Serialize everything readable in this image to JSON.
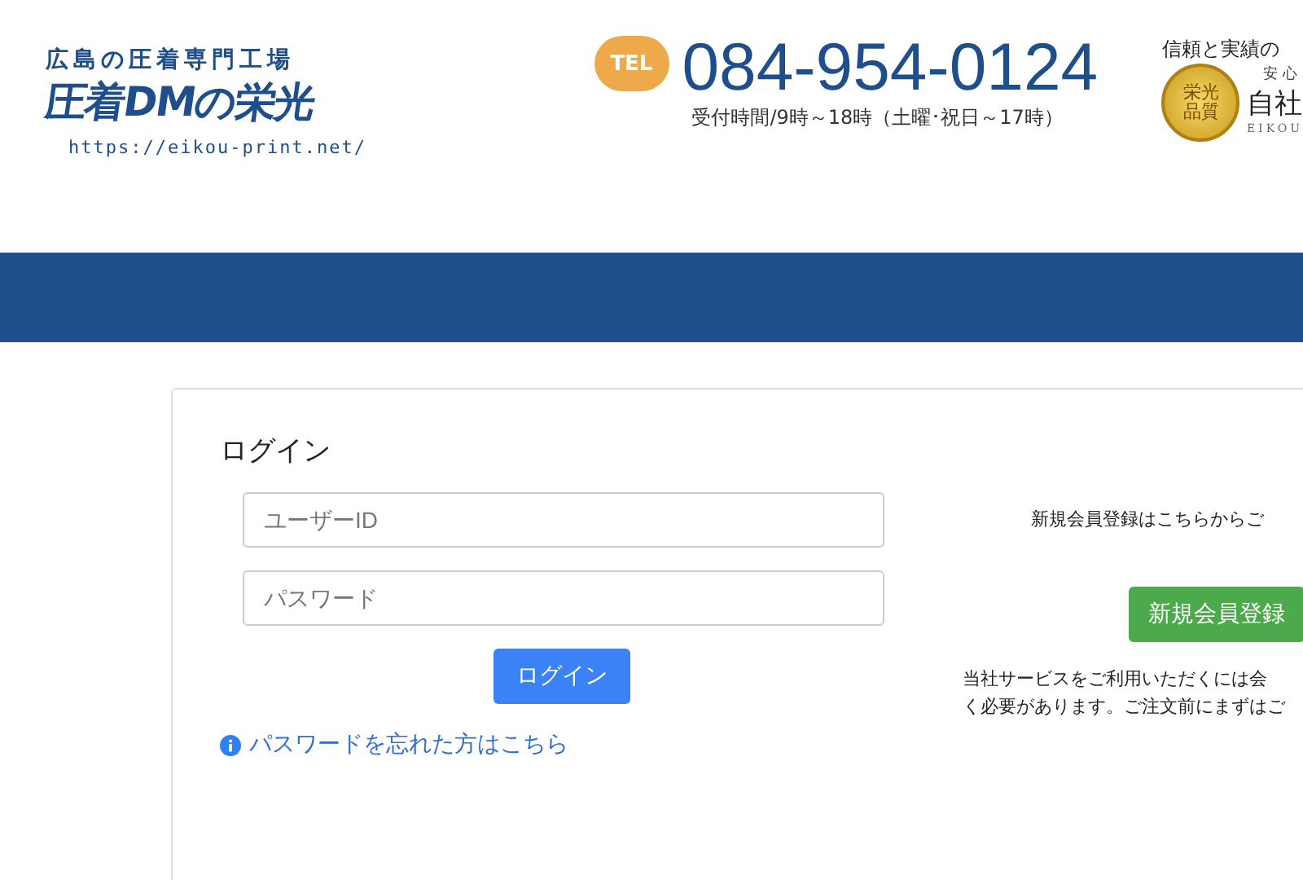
{
  "header": {
    "logo": {
      "tagline": "広島の圧着専門工場",
      "name": "圧着DMの栄光",
      "url": "https://eikou-print.net/"
    },
    "contact": {
      "tel_label": "TEL",
      "phone": "084-954-0124",
      "hours": "受付時間/9時～18時（土曜･祝日～17時）"
    },
    "quality": {
      "heading": "信頼と実績の",
      "badge_top": "栄光",
      "badge_bottom": "品質",
      "sub": "安心",
      "main": "自社",
      "roman": "EIKOU"
    }
  },
  "login": {
    "title": "ログイン",
    "user_field": {
      "placeholder": "ユーザーID"
    },
    "password_field": {
      "placeholder": "パスワード"
    },
    "button": "ログイン",
    "forgot_link": "パスワードを忘れた方はこちら"
  },
  "register": {
    "prompt": "新規会員登録はこちらからご",
    "button": "新規会員登録",
    "note_lines": [
      "当社サービスをご利用いただくには会",
      "く必要があります。ご注文前にまずはご"
    ]
  }
}
